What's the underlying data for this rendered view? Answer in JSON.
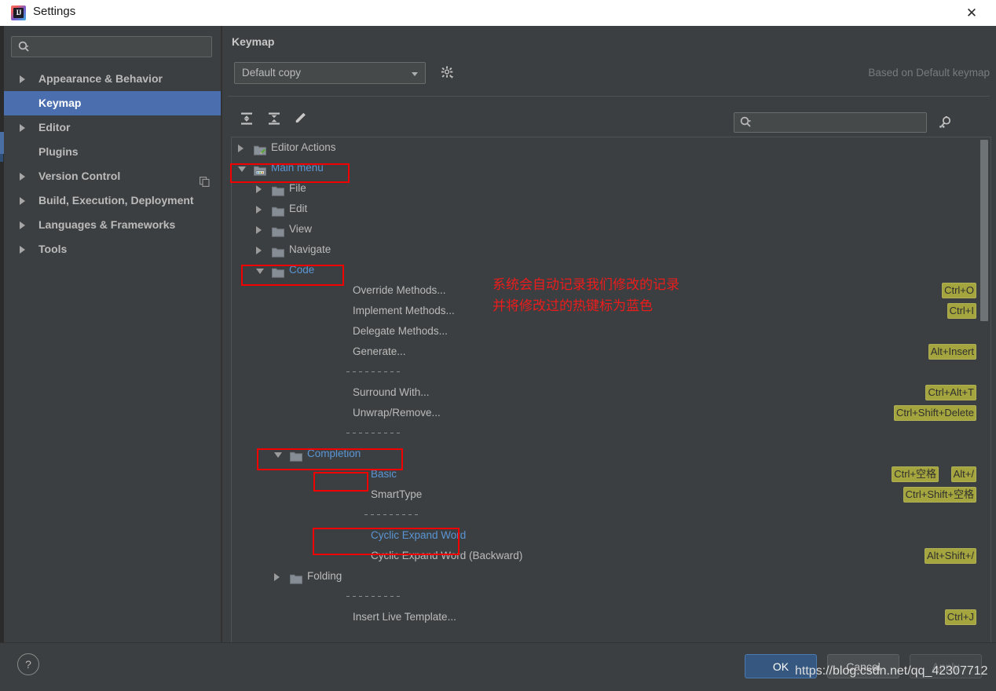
{
  "window": {
    "title": "Settings",
    "app_icon": "intellij-idea-icon",
    "close_label": "✕"
  },
  "sidebar": {
    "search_placeholder": "",
    "search_value": "",
    "items": [
      {
        "label": "Appearance & Behavior",
        "expandable": true,
        "selected": false
      },
      {
        "label": "Keymap",
        "expandable": false,
        "selected": true
      },
      {
        "label": "Editor",
        "expandable": true,
        "selected": false
      },
      {
        "label": "Plugins",
        "expandable": false,
        "selected": false
      },
      {
        "label": "Version Control",
        "expandable": true,
        "selected": false,
        "badge": "copy-icon"
      },
      {
        "label": "Build, Execution, Deployment",
        "expandable": true,
        "selected": false
      },
      {
        "label": "Languages & Frameworks",
        "expandable": true,
        "selected": false
      },
      {
        "label": "Tools",
        "expandable": true,
        "selected": false
      }
    ]
  },
  "panel": {
    "title": "Keymap",
    "keymap_select_value": "Default copy",
    "gear_icon": "gear-icon",
    "based_on": "Based on Default keymap",
    "toolbar": {
      "expand_all": "expand-all-icon",
      "collapse_all": "collapse-all-icon",
      "edit_shortcut": "edit-pencil-icon",
      "search_value": "",
      "filter_icon": "find-shortcut-icon"
    }
  },
  "tree": [
    {
      "label": "Editor Actions",
      "depth": 0,
      "type": "folder",
      "state": "closed",
      "icon": "editor-actions-icon",
      "blue": false,
      "shortcut": ""
    },
    {
      "label": "Main menu",
      "depth": 0,
      "type": "folder",
      "state": "open",
      "icon": "main-menu-icon",
      "blue": true,
      "shortcut": ""
    },
    {
      "label": "File",
      "depth": 1,
      "type": "folder",
      "state": "closed",
      "icon": "folder-icon",
      "blue": false,
      "shortcut": ""
    },
    {
      "label": "Edit",
      "depth": 1,
      "type": "folder",
      "state": "closed",
      "icon": "folder-icon",
      "blue": false,
      "shortcut": ""
    },
    {
      "label": "View",
      "depth": 1,
      "type": "folder",
      "state": "closed",
      "icon": "folder-icon",
      "blue": false,
      "shortcut": ""
    },
    {
      "label": "Navigate",
      "depth": 1,
      "type": "folder",
      "state": "closed",
      "icon": "folder-icon",
      "blue": false,
      "shortcut": ""
    },
    {
      "label": "Code",
      "depth": 1,
      "type": "folder",
      "state": "open",
      "icon": "folder-icon",
      "blue": true,
      "shortcut": ""
    },
    {
      "label": "Override Methods...",
      "depth": 2,
      "type": "action",
      "blue": false,
      "shortcut": "Ctrl+O"
    },
    {
      "label": "Implement Methods...",
      "depth": 2,
      "type": "action",
      "blue": false,
      "shortcut": "Ctrl+I"
    },
    {
      "label": "Delegate Methods...",
      "depth": 2,
      "type": "action",
      "blue": false,
      "shortcut": ""
    },
    {
      "label": "Generate...",
      "depth": 2,
      "type": "action",
      "blue": false,
      "shortcut": "Alt+Insert"
    },
    {
      "label": "",
      "depth": 2,
      "type": "separator",
      "blue": false,
      "shortcut": ""
    },
    {
      "label": "Surround With...",
      "depth": 2,
      "type": "action",
      "blue": false,
      "shortcut": "Ctrl+Alt+T"
    },
    {
      "label": "Unwrap/Remove...",
      "depth": 2,
      "type": "action",
      "blue": false,
      "shortcut": "Ctrl+Shift+Delete"
    },
    {
      "label": "",
      "depth": 2,
      "type": "separator",
      "blue": false,
      "shortcut": ""
    },
    {
      "label": "Completion",
      "depth": 2,
      "type": "folder",
      "state": "open",
      "icon": "folder-icon",
      "blue": true,
      "shortcut": ""
    },
    {
      "label": "Basic",
      "depth": 3,
      "type": "action",
      "blue": true,
      "shortcut": "Ctrl+空格",
      "shortcut2": "Alt+/"
    },
    {
      "label": "SmartType",
      "depth": 3,
      "type": "action",
      "blue": false,
      "shortcut": "Ctrl+Shift+空格"
    },
    {
      "label": "",
      "depth": 3,
      "type": "separator",
      "blue": false,
      "shortcut": ""
    },
    {
      "label": "Cyclic Expand Word",
      "depth": 3,
      "type": "action",
      "blue": true,
      "shortcut": ""
    },
    {
      "label": "Cyclic Expand Word (Backward)",
      "depth": 3,
      "type": "action",
      "blue": false,
      "shortcut": "Alt+Shift+/"
    },
    {
      "label": "Folding",
      "depth": 2,
      "type": "folder",
      "state": "closed",
      "icon": "folder-icon",
      "blue": false,
      "shortcut": ""
    },
    {
      "label": "",
      "depth": 2,
      "type": "separator",
      "blue": false,
      "shortcut": ""
    },
    {
      "label": "Insert Live Template...",
      "depth": 2,
      "type": "action",
      "blue": false,
      "shortcut": "Ctrl+J"
    }
  ],
  "annotations": {
    "line1": "系统会自动记录我们修改的记录",
    "line2": "并将修改过的热键标为蓝色",
    "color": "#ec1c1c"
  },
  "footer": {
    "help_label": "?",
    "ok_label": "OK",
    "cancel_label": "Cancel",
    "apply_label": "Apply",
    "watermark": "https://blog.csdn.net/qq_42307712"
  },
  "colors": {
    "window_bg": "#3c3f41",
    "selection_blue": "#4b6eaf",
    "modified_text_blue": "#5a95d4",
    "shortcut_badge": "#a5a53f",
    "annotation_red": "#f20000"
  }
}
